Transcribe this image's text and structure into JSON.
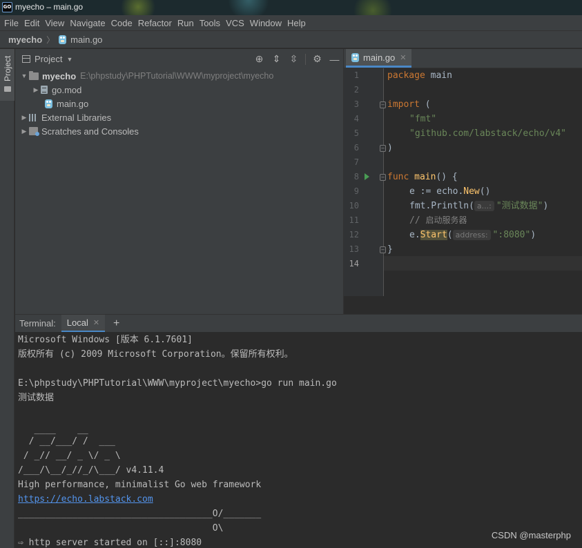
{
  "window": {
    "title": "myecho – main.go",
    "app_icon_text": "GO"
  },
  "menu": [
    "File",
    "Edit",
    "View",
    "Navigate",
    "Code",
    "Refactor",
    "Run",
    "Tools",
    "VCS",
    "Window",
    "Help"
  ],
  "breadcrumb": {
    "project": "myecho",
    "file": "main.go"
  },
  "side_tab": {
    "label": "Project"
  },
  "project_panel": {
    "title": "Project",
    "tools": [
      "locate-icon",
      "expand-all-icon",
      "collapse-all-icon",
      "gear-icon",
      "minimize-icon"
    ],
    "tree": [
      {
        "name": "myecho",
        "path": "E:\\phpstudy\\PHPTutorial\\WWW\\myproject\\myecho"
      },
      {
        "name": "go.mod"
      },
      {
        "name": "main.go"
      },
      {
        "name": "External Libraries"
      },
      {
        "name": "Scratches and Consoles"
      }
    ]
  },
  "editor": {
    "tab": "main.go",
    "line_numbers": [
      "1",
      "2",
      "3",
      "4",
      "5",
      "6",
      "7",
      "8",
      "9",
      "10",
      "11",
      "12",
      "13",
      "14"
    ],
    "code": {
      "l1_kw": "package",
      "l1_name": " main",
      "l3_kw": "import",
      "l3_paren": " (",
      "l4_str": "\"fmt\"",
      "l5_str": "\"github.com/labstack/echo/v4\"",
      "l6": ")",
      "l8_kw": "func",
      "l8_fn": " main",
      "l8_rest": "() {",
      "l9_a": "e := echo.",
      "l9_fn": "New",
      "l9_b": "()",
      "l10_a": "fmt.Println(",
      "l10_hint": "a...:",
      "l10_str": "\"测试数据\"",
      "l10_b": ")",
      "l11_cmt": "// ",
      "l11_cjk": "启动服务器",
      "l12_a": "e.",
      "l12_fn": "Start",
      "l12_b": "(",
      "l12_hint": "address:",
      "l12_str": "\":8080\"",
      "l12_c": ")",
      "l13": "}"
    }
  },
  "terminal": {
    "label": "Terminal:",
    "tab": "Local",
    "lines": [
      "Microsoft Windows [版本 6.1.7601]",
      "版权所有 (c) 2009 Microsoft Corporation。保留所有权利。",
      "",
      "E:\\phpstudy\\PHPTutorial\\WWW\\myproject\\myecho>go run main.go",
      "测试数据",
      "",
      "",
      "   ____    __",
      "  / __/___/ /  ___",
      " / _// __/ _ \\/ _ \\",
      "/___/\\__/_//_/\\___/ v4.11.4",
      "High performance, minimalist Go web framework",
      "https://echo.labstack.com",
      "____________________________________O/_______",
      "                                    O\\",
      "⇨ http server started on [::]:8080"
    ]
  },
  "watermark": "CSDN @masterphp"
}
